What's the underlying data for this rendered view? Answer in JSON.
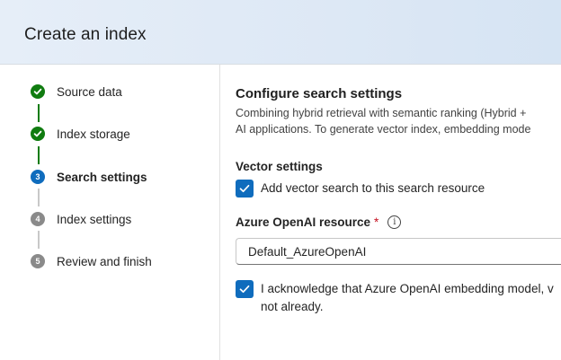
{
  "header": {
    "title": "Create an index"
  },
  "steps": [
    {
      "label": "Source data",
      "status": "done",
      "marker": ""
    },
    {
      "label": "Index storage",
      "status": "done",
      "marker": ""
    },
    {
      "label": "Search settings",
      "status": "current",
      "marker": "3"
    },
    {
      "label": "Index settings",
      "status": "todo",
      "marker": "4"
    },
    {
      "label": "Review and finish",
      "status": "todo",
      "marker": "5"
    }
  ],
  "main": {
    "section_title": "Configure search settings",
    "description_line1": "Combining hybrid retrieval with semantic ranking (Hybrid +",
    "description_line2": "AI applications. To generate vector index, embedding mode",
    "vector_settings_title": "Vector settings",
    "vector_checkbox_label": "Add vector search to this search resource",
    "vector_checkbox_checked": true,
    "openai_label": "Azure OpenAI resource",
    "required_marker": "*",
    "info_glyph": "i",
    "openai_value": "Default_AzureOpenAI",
    "ack_line1": "I acknowledge that Azure OpenAI embedding model, v",
    "ack_line2": "not already.",
    "ack_checked": true
  },
  "colors": {
    "accent": "#0f6cbd",
    "done": "#107c10",
    "pending": "#8a8a8a",
    "required": "#c50f1f"
  }
}
